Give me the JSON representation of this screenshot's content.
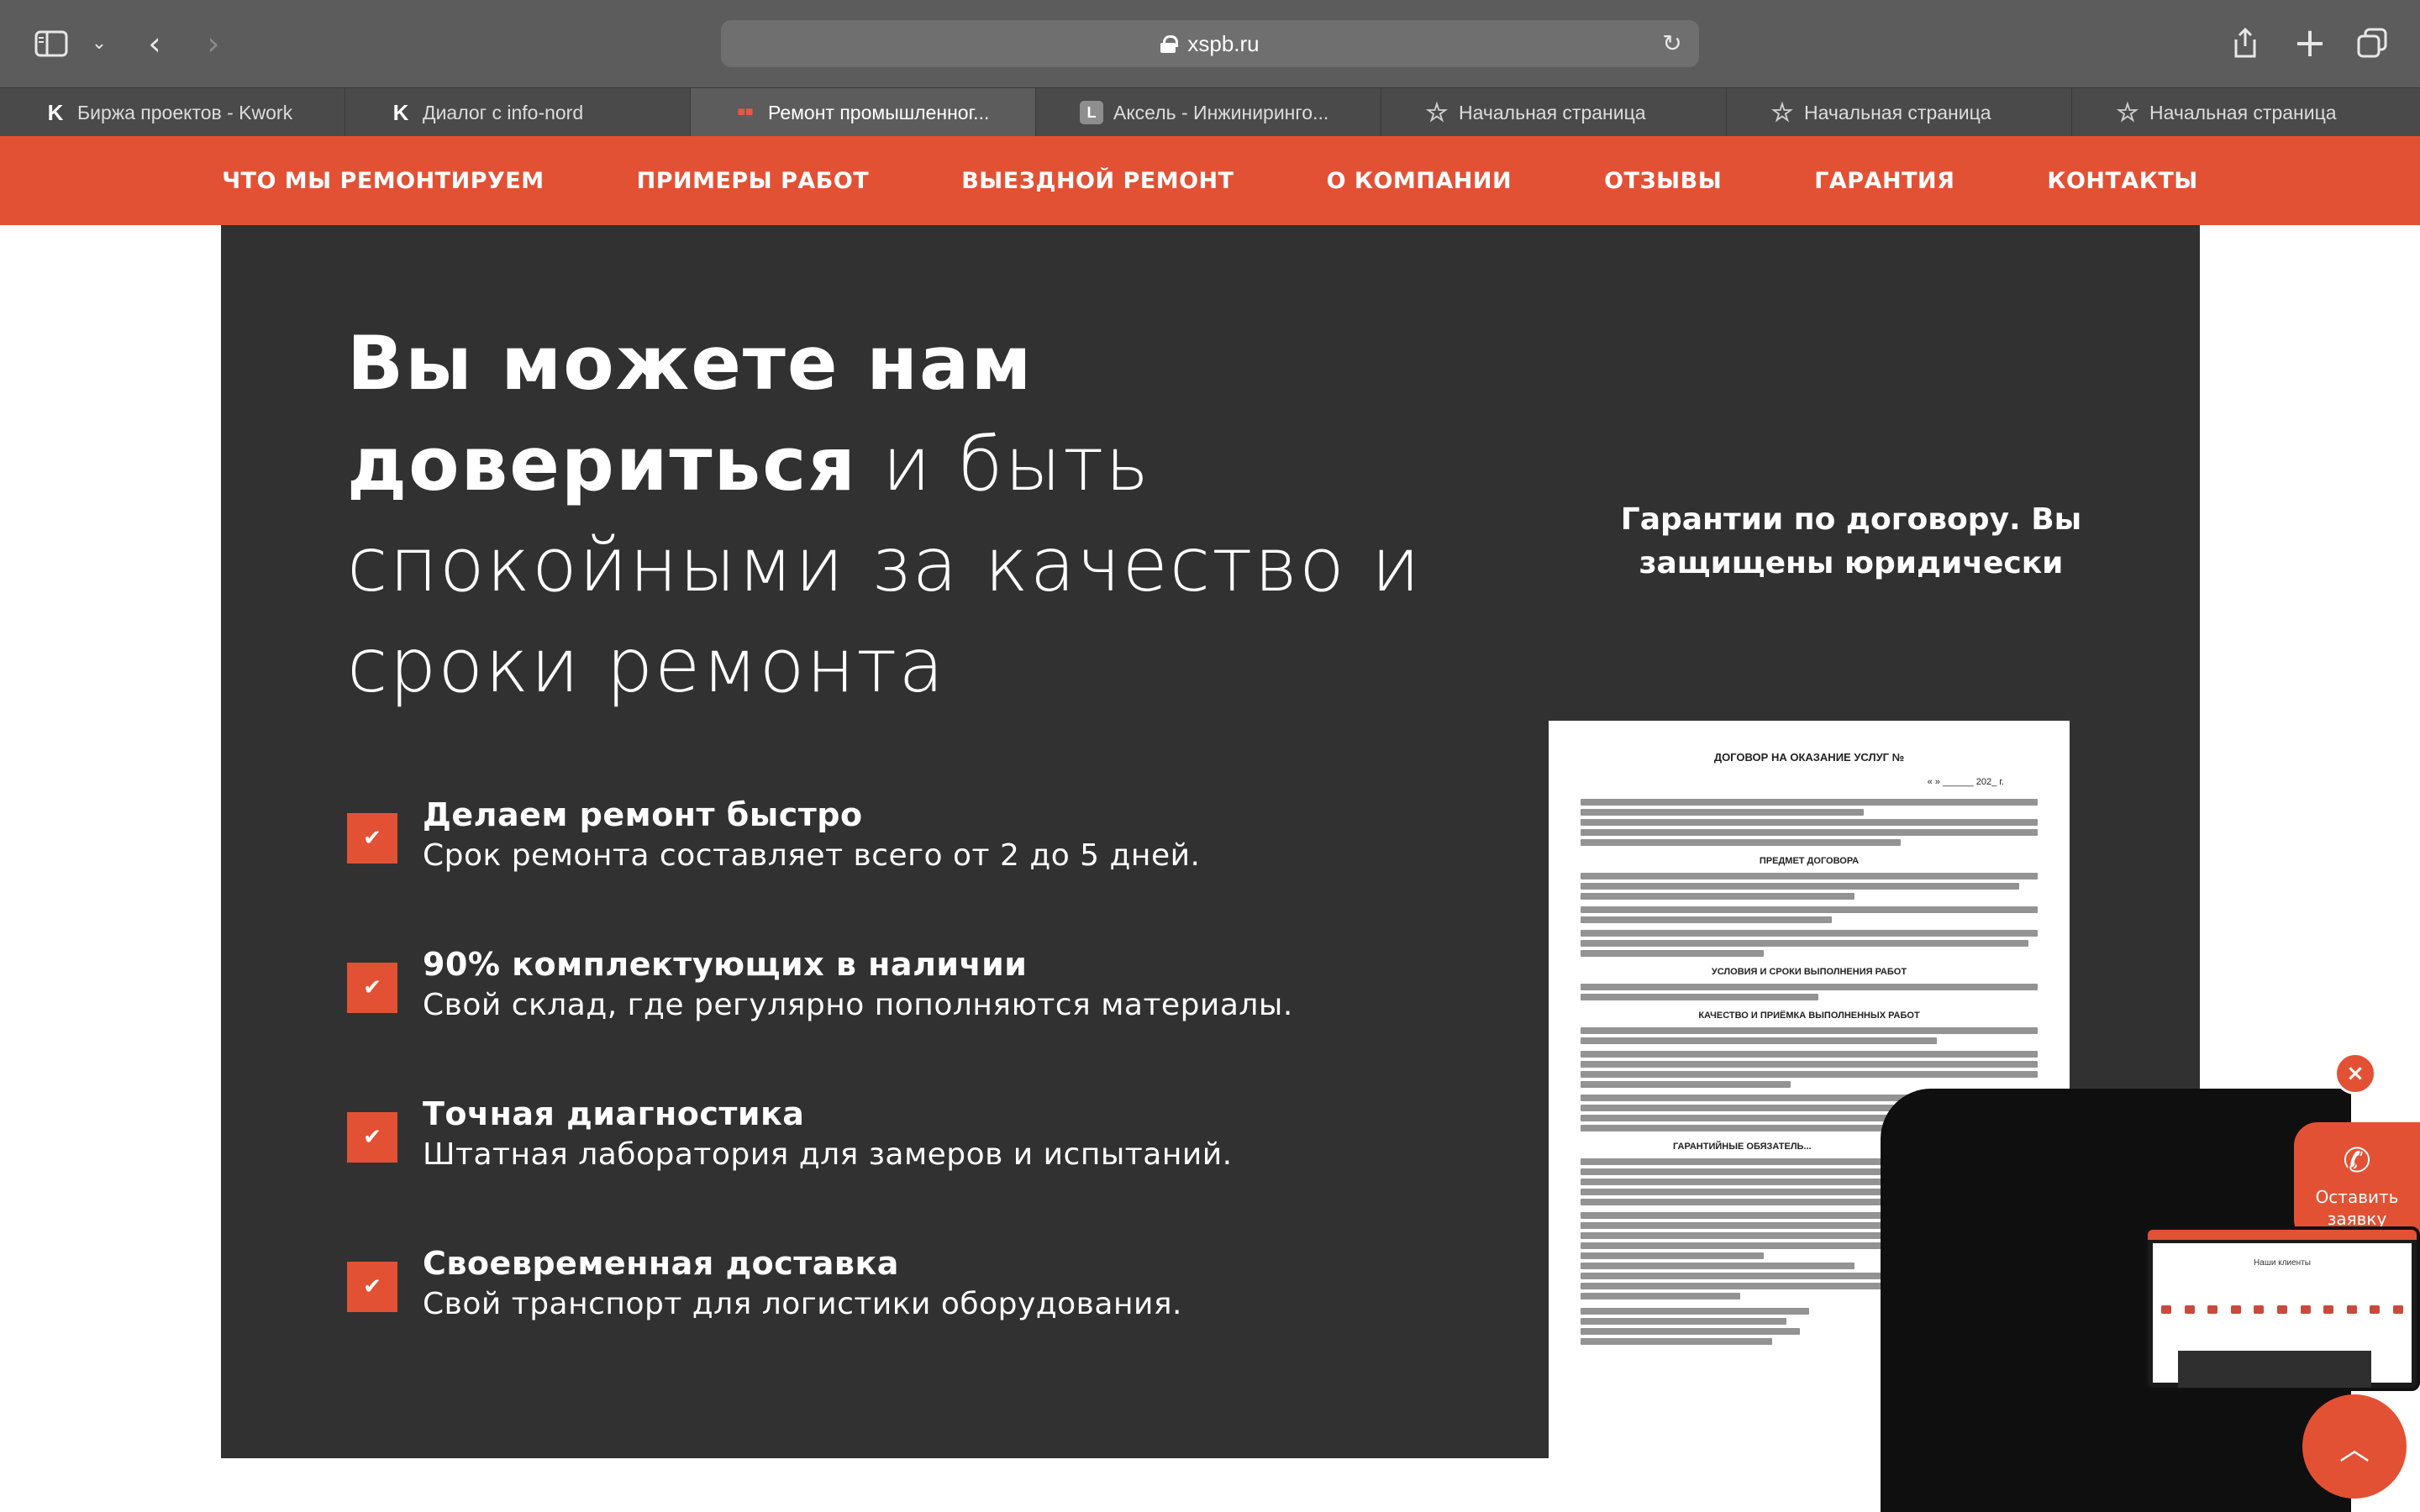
{
  "browser": {
    "url": "xspb.ru",
    "tabs": [
      {
        "label": "Биржа проектов - Kwork",
        "icon": "kwork-icon",
        "active": false
      },
      {
        "label": "Диалог с info-nord",
        "icon": "kwork-icon",
        "active": false
      },
      {
        "label": "Ремонт промышленног...",
        "icon": "xspb-icon",
        "active": true
      },
      {
        "label": "Аксель - Инжиниринго...",
        "icon": "letter-l-icon",
        "active": false
      },
      {
        "label": "Начальная страница",
        "icon": "star-icon",
        "active": false
      },
      {
        "label": "Начальная страница",
        "icon": "star-icon",
        "active": false
      },
      {
        "label": "Начальная страница",
        "icon": "star-icon",
        "active": false
      }
    ]
  },
  "nav": {
    "items": [
      "ЧТО МЫ РЕМОНТИРУЕМ",
      "ПРИМЕРЫ РАБОТ",
      "ВЫЕЗДНОЙ РЕМОНТ",
      "О КОМПАНИИ",
      "ОТЗЫВЫ",
      "ГАРАНТИЯ",
      "КОНТАКТЫ"
    ]
  },
  "hero": {
    "headline_bold": "Вы можете нам довериться",
    "headline_rest": " и быть спокойными за качество и сроки ремонта"
  },
  "features": [
    {
      "title": "Делаем ремонт быстро",
      "desc": "Срок ремонта составляет всего от 2 до 5 дней."
    },
    {
      "title": "90% комплектующих в наличии",
      "desc": "Свой склад, где регулярно пополняются материалы."
    },
    {
      "title": "Точная диагностика",
      "desc": "Штатная лаборатория для замеров и испытаний."
    },
    {
      "title": "Своевременная доставка",
      "desc": "Свой транспорт для логистики оборудования."
    }
  ],
  "guarantee": {
    "text": "Гарантии по договору. Вы защищены юридически"
  },
  "document": {
    "title": "ДОГОВОР НА ОКАЗАНИЕ УСЛУГ №",
    "date": "« » ______ 202_ г.",
    "sections": [
      "ПРЕДМЕТ ДОГОВОРА",
      "УСЛОВИЯ И СРОКИ ВЫПОЛНЕНИЯ РАБОТ",
      "КАЧЕСТВО И ПРИЁМКА ВЫПОЛНЕННЫХ РАБОТ",
      "ГАРАНТИЙНЫЕ ОБЯЗАТЕЛЬ..."
    ]
  },
  "widgets": {
    "cta_label": "Оставить заявку",
    "preview_title": "Наши клиенты"
  },
  "colors": {
    "accent": "#e35135",
    "dark": "#313131"
  }
}
